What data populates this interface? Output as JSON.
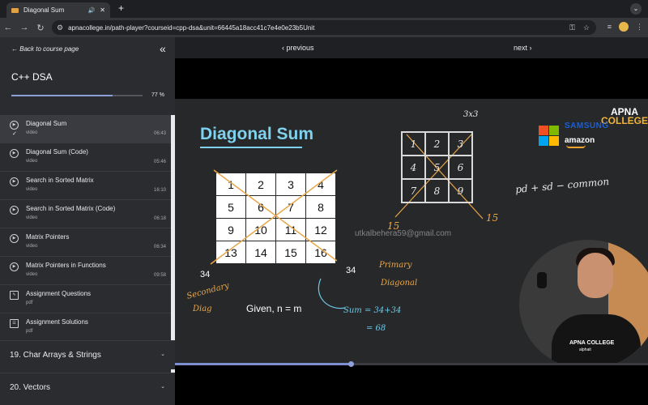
{
  "browser": {
    "tab_title": "Diagonal Sum",
    "new_tab": "+",
    "url": "apnacollege.in/path-player?courseid=cpp-dsa&unit=66445a18acc41c7e4e0e23b5Unit"
  },
  "sidebar": {
    "back_label": "Back to course page",
    "collapse_icon": "double-chevron-left-icon",
    "course_title": "C++ DSA",
    "progress_fraction": 0.77,
    "progress_label": "77 %",
    "items": [
      {
        "title": "Diagonal Sum",
        "type": "video",
        "duration": "06:43",
        "icon": "play-circle-icon",
        "active": true,
        "completed": true
      },
      {
        "title": "Diagonal Sum (Code)",
        "type": "video",
        "duration": "05:46",
        "icon": "play-circle-icon"
      },
      {
        "title": "Search in Sorted Matrix",
        "type": "video",
        "duration": "16:10",
        "icon": "play-circle-icon"
      },
      {
        "title": "Search in Sorted Matrix (Code)",
        "type": "video",
        "duration": "06:18",
        "icon": "play-circle-icon"
      },
      {
        "title": "Matrix Pointers",
        "type": "video",
        "duration": "06:34",
        "icon": "play-circle-icon"
      },
      {
        "title": "Matrix Pointers in Functions",
        "type": "video",
        "duration": "09:58",
        "icon": "play-circle-icon"
      },
      {
        "title": "Assignment Questions",
        "type": "pdf",
        "duration": "",
        "icon": "edit-document-icon"
      },
      {
        "title": "Assignment Solutions",
        "type": "pdf",
        "duration": "",
        "icon": "checklist-icon"
      }
    ],
    "sections": [
      "19. Char Arrays & Strings",
      "20. Vectors"
    ]
  },
  "player": {
    "previous_label": "‹ previous",
    "next_label": "next ›",
    "seek_fraction": 0.371
  },
  "video": {
    "title": "Diagonal Sum",
    "matrix": [
      "1",
      "2",
      "3",
      "4",
      "5",
      "6",
      "7",
      "8",
      "9",
      "10",
      "11",
      "12",
      "13",
      "14",
      "15",
      "16"
    ],
    "label_34_left": "34",
    "label_34_right": "34",
    "given": "Given, n = m",
    "watermark": "utkalbehera59@gmail.com",
    "note_3x3": "3x3",
    "matrix3": [
      "1",
      "2",
      "3",
      "4",
      "5",
      "6",
      "7",
      "8",
      "9"
    ],
    "note_15_left": "15",
    "note_15_right": "15",
    "note_formula": "pd + sd − common",
    "note_primary": "Primary",
    "note_diagonal": "Diagonal",
    "note_secondary": "Secondary",
    "note_diag": "Diag",
    "note_sum": "Sum = 34+34",
    "note_total": "= 68",
    "logo_line1": "APNA",
    "logo_line2": "COLLEGE",
    "sponsor_samsung": "SAMSUNG",
    "sponsor_amazon": "amazon",
    "presenter_shirt": "APNA COLLEGE",
    "presenter_shirt2": "alphait"
  }
}
